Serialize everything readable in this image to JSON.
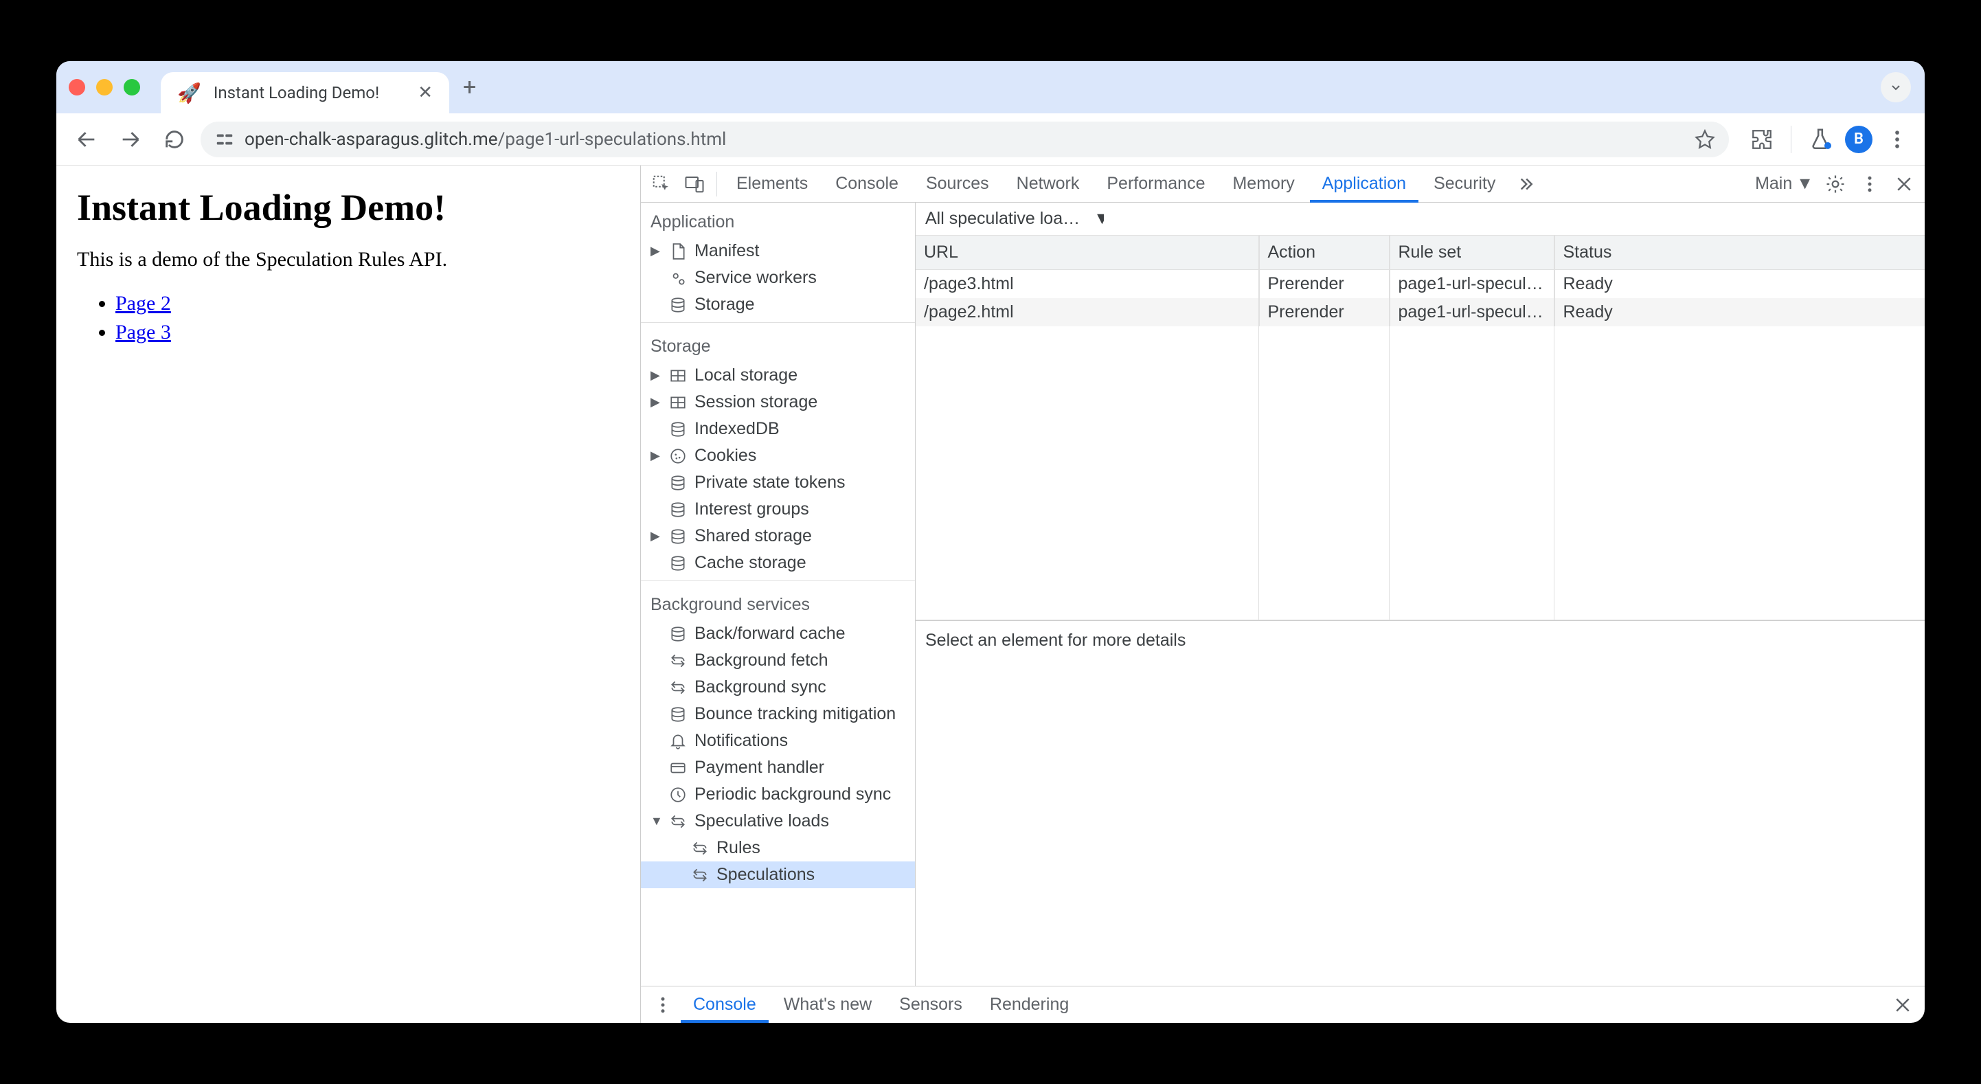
{
  "browser": {
    "tab_title": "Instant Loading Demo!",
    "url_host": "open-chalk-asparagus.glitch.me",
    "url_path": "/page1-url-speculations.html",
    "avatar_letter": "B"
  },
  "page": {
    "heading": "Instant Loading Demo!",
    "description": "This is a demo of the Speculation Rules API.",
    "links": [
      {
        "text": "Page 2"
      },
      {
        "text": "Page 3"
      }
    ]
  },
  "devtools": {
    "tabs": [
      "Elements",
      "Console",
      "Sources",
      "Network",
      "Performance",
      "Memory",
      "Application",
      "Security"
    ],
    "active_tab": "Application",
    "target_label": "Main",
    "sidebar": {
      "groups": [
        {
          "title": "Application",
          "items": [
            {
              "label": "Manifest",
              "icon": "file",
              "expandable": true
            },
            {
              "label": "Service workers",
              "icon": "gears"
            },
            {
              "label": "Storage",
              "icon": "db"
            }
          ]
        },
        {
          "title": "Storage",
          "items": [
            {
              "label": "Local storage",
              "icon": "grid",
              "expandable": true
            },
            {
              "label": "Session storage",
              "icon": "grid",
              "expandable": true
            },
            {
              "label": "IndexedDB",
              "icon": "db"
            },
            {
              "label": "Cookies",
              "icon": "cookie",
              "expandable": true
            },
            {
              "label": "Private state tokens",
              "icon": "db"
            },
            {
              "label": "Interest groups",
              "icon": "db"
            },
            {
              "label": "Shared storage",
              "icon": "db",
              "expandable": true
            },
            {
              "label": "Cache storage",
              "icon": "db"
            }
          ]
        },
        {
          "title": "Background services",
          "items": [
            {
              "label": "Back/forward cache",
              "icon": "db"
            },
            {
              "label": "Background fetch",
              "icon": "sync"
            },
            {
              "label": "Background sync",
              "icon": "sync"
            },
            {
              "label": "Bounce tracking mitigation",
              "icon": "db"
            },
            {
              "label": "Notifications",
              "icon": "bell"
            },
            {
              "label": "Payment handler",
              "icon": "card"
            },
            {
              "label": "Periodic background sync",
              "icon": "clock"
            },
            {
              "label": "Speculative loads",
              "icon": "sync",
              "expandable": true,
              "expanded": true,
              "children": [
                {
                  "label": "Rules",
                  "icon": "sync"
                },
                {
                  "label": "Speculations",
                  "icon": "sync",
                  "selected": true
                }
              ]
            }
          ]
        }
      ]
    },
    "filter_label": "All speculative loa…",
    "table": {
      "columns": [
        "URL",
        "Action",
        "Rule set",
        "Status"
      ],
      "rows": [
        {
          "url": "/page3.html",
          "action": "Prerender",
          "ruleset": "page1-url-specul…",
          "status": "Ready"
        },
        {
          "url": "/page2.html",
          "action": "Prerender",
          "ruleset": "page1-url-specul…",
          "status": "Ready"
        }
      ]
    },
    "details_placeholder": "Select an element for more details",
    "drawer_tabs": [
      "Console",
      "What's new",
      "Sensors",
      "Rendering"
    ],
    "drawer_active": "Console"
  }
}
